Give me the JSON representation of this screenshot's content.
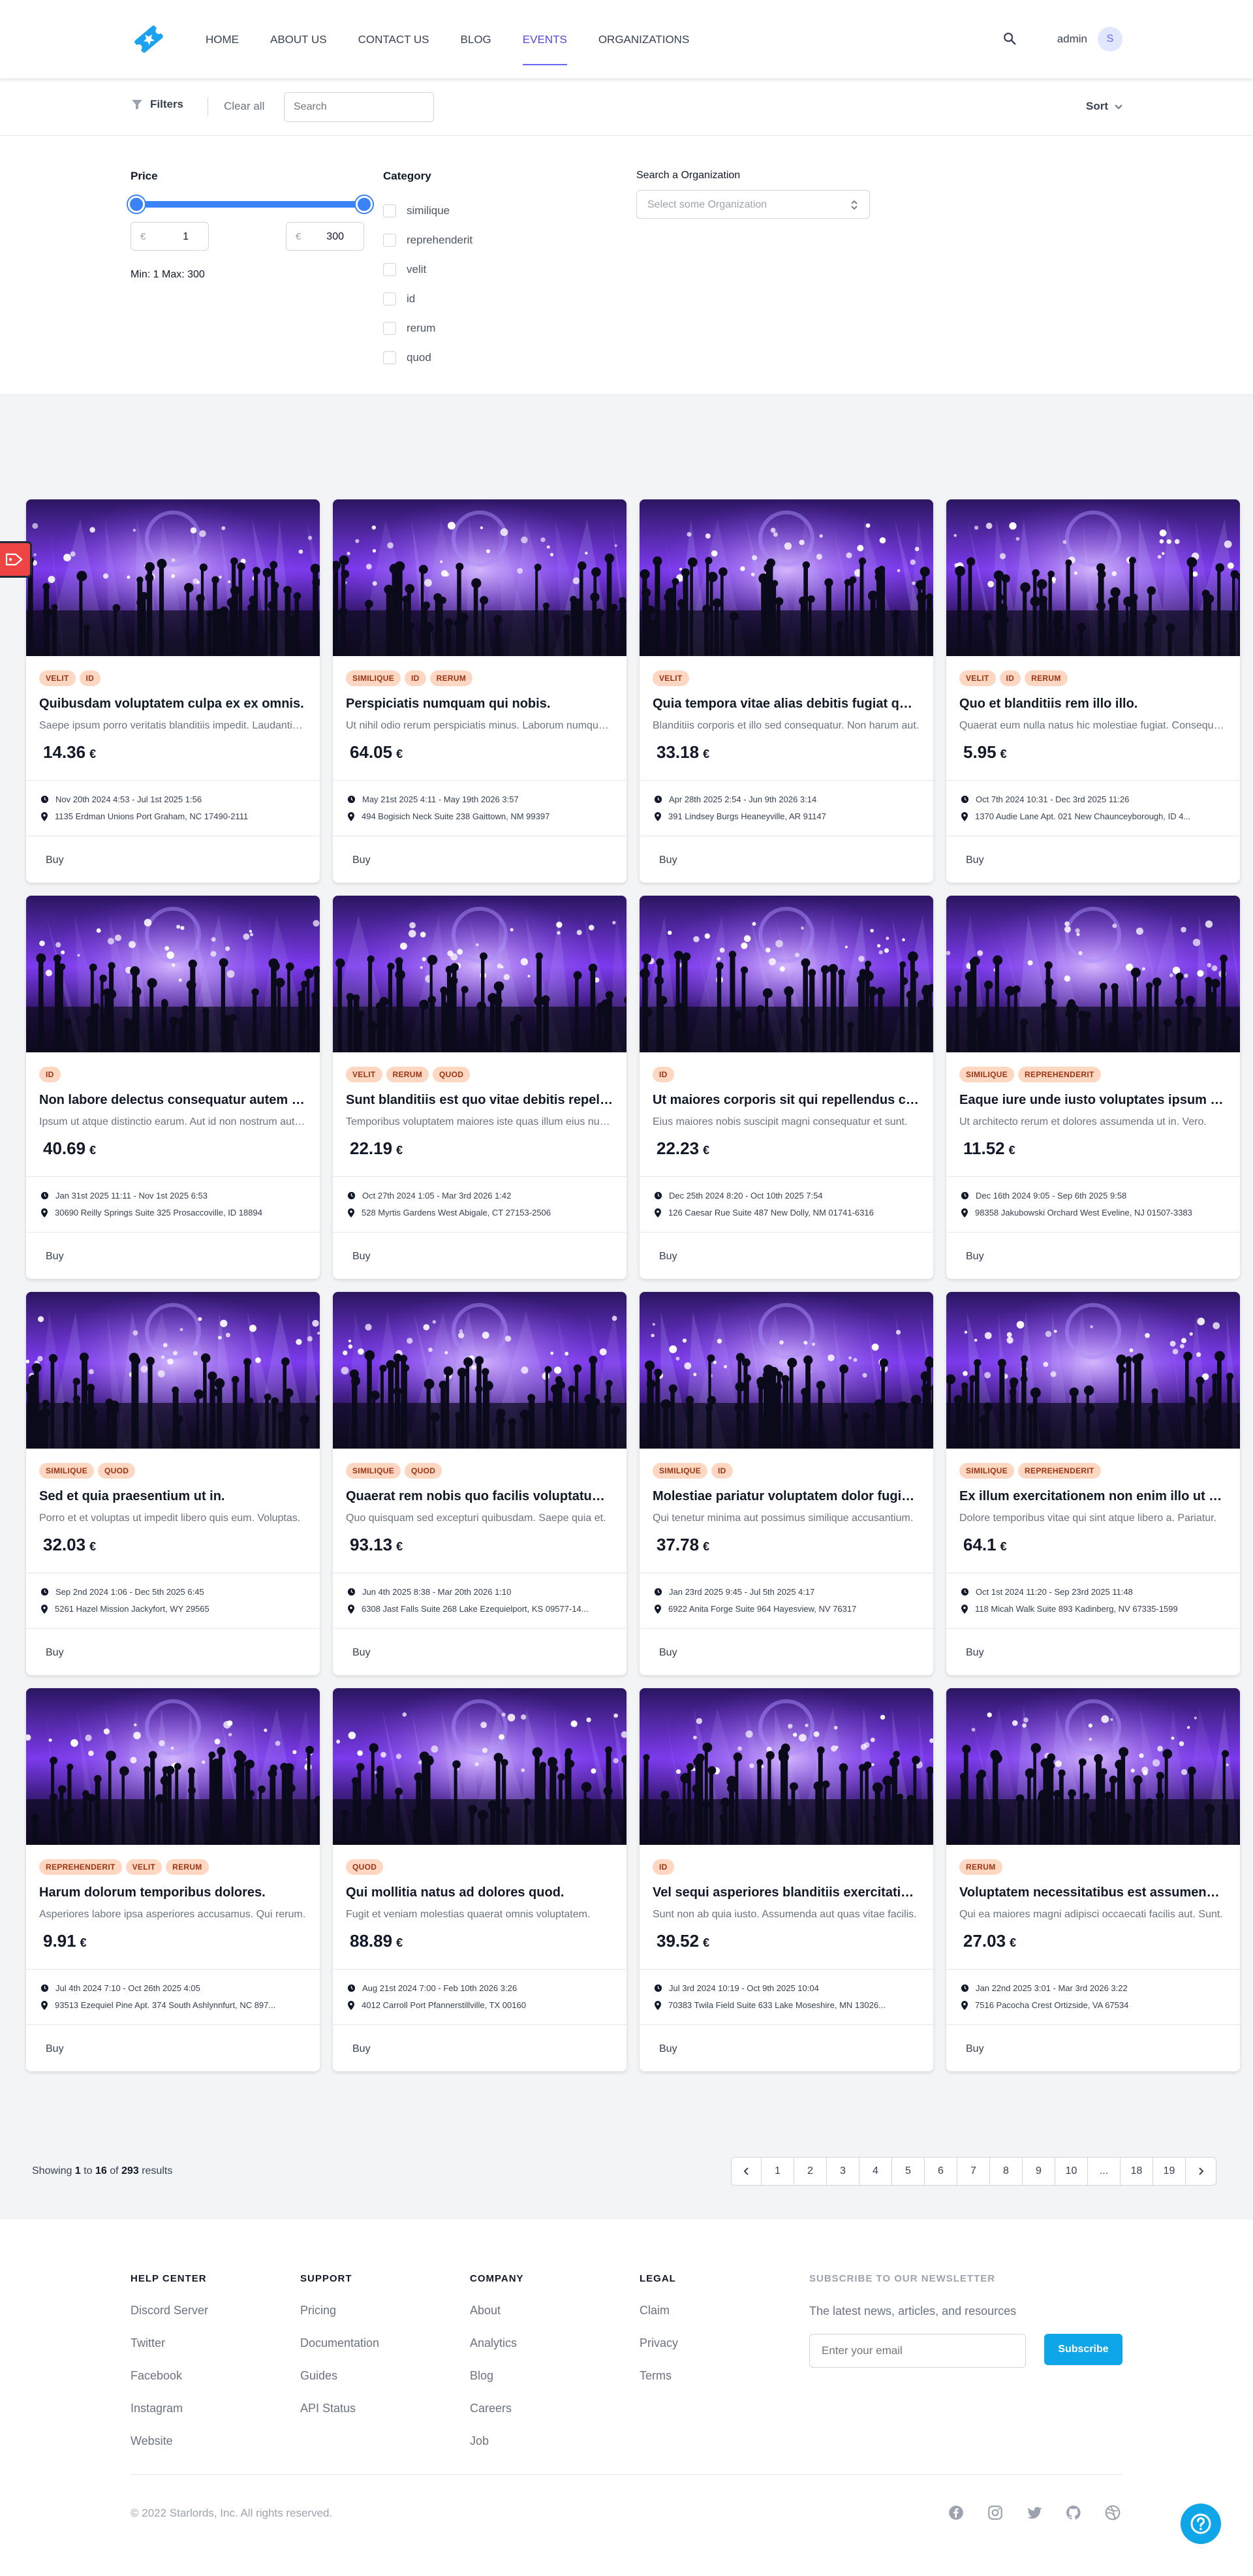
{
  "header": {
    "nav": [
      "HOME",
      "ABOUT US",
      "CONTACT US",
      "BLOG",
      "EVENTS",
      "ORGANIZATIONS"
    ],
    "active": "EVENTS",
    "user": "admin",
    "avatar_initial": "S"
  },
  "filterbar": {
    "filters_label": "Filters",
    "clear_label": "Clear all",
    "search_placeholder": "Search",
    "sort_label": "Sort"
  },
  "panel": {
    "price_label": "Price",
    "price_min": {
      "currency": "€",
      "value": "1"
    },
    "price_max": {
      "currency": "€",
      "value": "300"
    },
    "minmax_text": "Min: 1 Max: 300",
    "category_label": "Category",
    "categories": [
      "similique",
      "reprehenderit",
      "velit",
      "id",
      "rerum",
      "quod"
    ],
    "org_label": "Search a Organization",
    "org_placeholder": "Select some Organization"
  },
  "events": [
    {
      "tags": [
        "VELIT",
        "ID"
      ],
      "title": "Quibusdam voluptatem culpa ex ex omnis.",
      "desc": "Saepe ipsum porro veritatis blanditiis impedit. Laudantium voluptatem.",
      "price": "14.36",
      "currency": "€",
      "dates": "Nov 20th 2024 4:53 - Jul 1st 2025 1:56",
      "address": "1135 Erdman Unions Port Graham, NC 17490-2111",
      "buy": "Buy"
    },
    {
      "tags": [
        "SIMILIQUE",
        "ID",
        "RERUM"
      ],
      "title": "Perspiciatis numquam qui nobis.",
      "desc": "Ut nihil odio rerum perspiciatis minus. Laborum numquam dolores.",
      "price": "64.05",
      "currency": "€",
      "dates": "May 21st 2025 4:11 - May 19th 2026 3:57",
      "address": "494 Bogisich Neck Suite 238 Gaittown, NM 99397",
      "buy": "Buy"
    },
    {
      "tags": [
        "VELIT"
      ],
      "title": "Quia tempora vitae alias debitis fugiat quia.",
      "desc": "Blanditiis corporis et illo sed consequatur. Non harum aut.",
      "price": "33.18",
      "currency": "€",
      "dates": "Apr 28th 2025 2:54 - Jun 9th 2026 3:14",
      "address": "391 Lindsey Burgs Heaneyville, AR 91147",
      "buy": "Buy"
    },
    {
      "tags": [
        "VELIT",
        "ID",
        "RERUM"
      ],
      "title": "Quo et blanditiis rem illo illo.",
      "desc": "Quaerat eum nulla natus hic molestiae fugiat. Consequatur et.",
      "price": "5.95",
      "currency": "€",
      "dates": "Oct 7th 2024 10:31 - Dec 3rd 2025 11:26",
      "address": "1370 Audie Lane Apt. 021 New Chaunceyborough, ID 4...",
      "buy": "Buy"
    },
    {
      "tags": [
        "ID"
      ],
      "title": "Non labore delectus consequatur autem quia.",
      "desc": "Ipsum ut atque distinctio earum. Aut id non nostrum autem.",
      "price": "40.69",
      "currency": "€",
      "dates": "Jan 31st 2025 11:11 - Nov 1st 2025 6:53",
      "address": "30690 Reilly Springs Suite 325 Prosaccoville, ID 18894",
      "buy": "Buy"
    },
    {
      "tags": [
        "VELIT",
        "RERUM",
        "QUOD"
      ],
      "title": "Sunt blanditiis est quo vitae debitis repellat.",
      "desc": "Temporibus voluptatem maiores iste quas illum eius numquam.",
      "price": "22.19",
      "currency": "€",
      "dates": "Oct 27th 2024 1:05 - Mar 3rd 2026 1:42",
      "address": "528 Myrtis Gardens West Abigale, CT 27153-2506",
      "buy": "Buy"
    },
    {
      "tags": [
        "ID"
      ],
      "title": "Ut maiores corporis sit qui repellendus culpa.",
      "desc": "Eius maiores nobis suscipit magni consequatur et sunt.",
      "price": "22.23",
      "currency": "€",
      "dates": "Dec 25th 2024 8:20 - Oct 10th 2025 7:54",
      "address": "126 Caesar Rue Suite 487 New Dolly, NM 01741-6316",
      "buy": "Buy"
    },
    {
      "tags": [
        "SIMILIQUE",
        "REPREHENDERIT"
      ],
      "title": "Eaque iure unde iusto voluptates ipsum illum.",
      "desc": "Ut architecto rerum et dolores assumenda ut in. Vero.",
      "price": "11.52",
      "currency": "€",
      "dates": "Dec 16th 2024 9:05 - Sep 6th 2025 9:58",
      "address": "98358 Jakubowski Orchard West Eveline, NJ 01507-3383",
      "buy": "Buy"
    },
    {
      "tags": [
        "SIMILIQUE",
        "QUOD"
      ],
      "title": "Sed et quia praesentium ut in.",
      "desc": "Porro et et voluptas ut impedit libero quis eum. Voluptas.",
      "price": "32.03",
      "currency": "€",
      "dates": "Sep 2nd 2024 1:06 - Dec 5th 2025 6:45",
      "address": "5261 Hazel Mission Jackyfort, WY 29565",
      "buy": "Buy"
    },
    {
      "tags": [
        "SIMILIQUE",
        "QUOD"
      ],
      "title": "Quaerat rem nobis quo facilis voluptatum nihil.",
      "desc": "Quo quisquam sed excepturi quibusdam. Saepe quia et.",
      "price": "93.13",
      "currency": "€",
      "dates": "Jun 4th 2025 8:38 - Mar 20th 2026 1:10",
      "address": "6308 Jast Falls Suite 268 Lake Ezequielport, KS 09577-14...",
      "buy": "Buy"
    },
    {
      "tags": [
        "SIMILIQUE",
        "ID"
      ],
      "title": "Molestiae pariatur voluptatem dolor fugiat sit.",
      "desc": "Qui tenetur minima aut possimus similique accusantium.",
      "price": "37.78",
      "currency": "€",
      "dates": "Jan 23rd 2025 9:45 - Jul 5th 2025 4:17",
      "address": "6922 Anita Forge Suite 964 Hayesview, NV 76317",
      "buy": "Buy"
    },
    {
      "tags": [
        "SIMILIQUE",
        "REPREHENDERIT"
      ],
      "title": "Ex illum exercitationem non enim illo ut sint.",
      "desc": "Dolore temporibus vitae qui sint atque libero a. Pariatur.",
      "price": "64.1",
      "currency": "€",
      "dates": "Oct 1st 2024 11:20 - Sep 23rd 2025 11:48",
      "address": "118 Micah Walk Suite 893 Kadinberg, NV 67335-1599",
      "buy": "Buy"
    },
    {
      "tags": [
        "REPREHENDERIT",
        "VELIT",
        "RERUM"
      ],
      "title": "Harum dolorum temporibus dolores.",
      "desc": "Asperiores labore ipsa asperiores accusamus. Qui rerum.",
      "price": "9.91",
      "currency": "€",
      "dates": "Jul 4th 2024 7:10 - Oct 26th 2025 4:05",
      "address": "93513 Ezequiel Pine Apt. 374 South Ashlynnfurt, NC 897...",
      "buy": "Buy"
    },
    {
      "tags": [
        "QUOD"
      ],
      "title": "Qui mollitia natus ad dolores quod.",
      "desc": "Fugit et veniam molestias quaerat omnis voluptatem.",
      "price": "88.89",
      "currency": "€",
      "dates": "Aug 21st 2024 7:00 - Feb 10th 2026 3:26",
      "address": "4012 Carroll Port Pfannerstillville, TX 00160",
      "buy": "Buy"
    },
    {
      "tags": [
        "ID"
      ],
      "title": "Vel sequi asperiores blanditiis exercitationem.",
      "desc": "Sunt non ab quia iusto. Assumenda aut quas vitae facilis.",
      "price": "39.52",
      "currency": "€",
      "dates": "Jul 3rd 2024 10:19 - Oct 9th 2025 10:04",
      "address": "70383 Twila Field Suite 633 Lake Moseshire, MN 13026...",
      "buy": "Buy"
    },
    {
      "tags": [
        "RERUM"
      ],
      "title": "Voluptatem necessitatibus est assumenda ut.",
      "desc": "Qui ea maiores magni adipisci occaecati facilis aut. Sunt.",
      "price": "27.03",
      "currency": "€",
      "dates": "Jan 22nd 2025 3:01 - Mar 3rd 2026 3:22",
      "address": "7516 Pacocha Crest Ortizside, VA 67534",
      "buy": "Buy"
    }
  ],
  "pagination": {
    "showing": "Showing",
    "from": "1",
    "to_word": "to",
    "to": "16",
    "of_word": "of",
    "total": "293",
    "results_word": "results",
    "pages": [
      "1",
      "2",
      "3",
      "4",
      "5",
      "6",
      "7",
      "8",
      "9",
      "10",
      "...",
      "18",
      "19"
    ]
  },
  "footer": {
    "columns": [
      {
        "title": "HELP CENTER",
        "links": [
          "Discord Server",
          "Twitter",
          "Facebook",
          "Instagram",
          "Website"
        ]
      },
      {
        "title": "SUPPORT",
        "links": [
          "Pricing",
          "Documentation",
          "Guides",
          "API Status"
        ]
      },
      {
        "title": "COMPANY",
        "links": [
          "About",
          "Analytics",
          "Blog",
          "Careers",
          "Job"
        ]
      },
      {
        "title": "LEGAL",
        "links": [
          "Claim",
          "Privacy",
          "Terms"
        ]
      }
    ],
    "newsletter_title": "SUBSCRIBE TO OUR NEWSLETTER",
    "newsletter_text": "The latest news, articles, and resources",
    "email_placeholder": "Enter your email",
    "subscribe": "Subscribe",
    "copyright": "© 2022 Starlords, Inc. All rights reserved.",
    "socials": [
      "facebook-icon",
      "instagram-icon",
      "twitter-icon",
      "github-icon",
      "dribbble-icon"
    ]
  },
  "colors": {
    "accent": "#3b82f6",
    "tag_bg": "#fed7c3",
    "tag_text": "#9a3412",
    "subscribe": "#0ea5e9"
  }
}
